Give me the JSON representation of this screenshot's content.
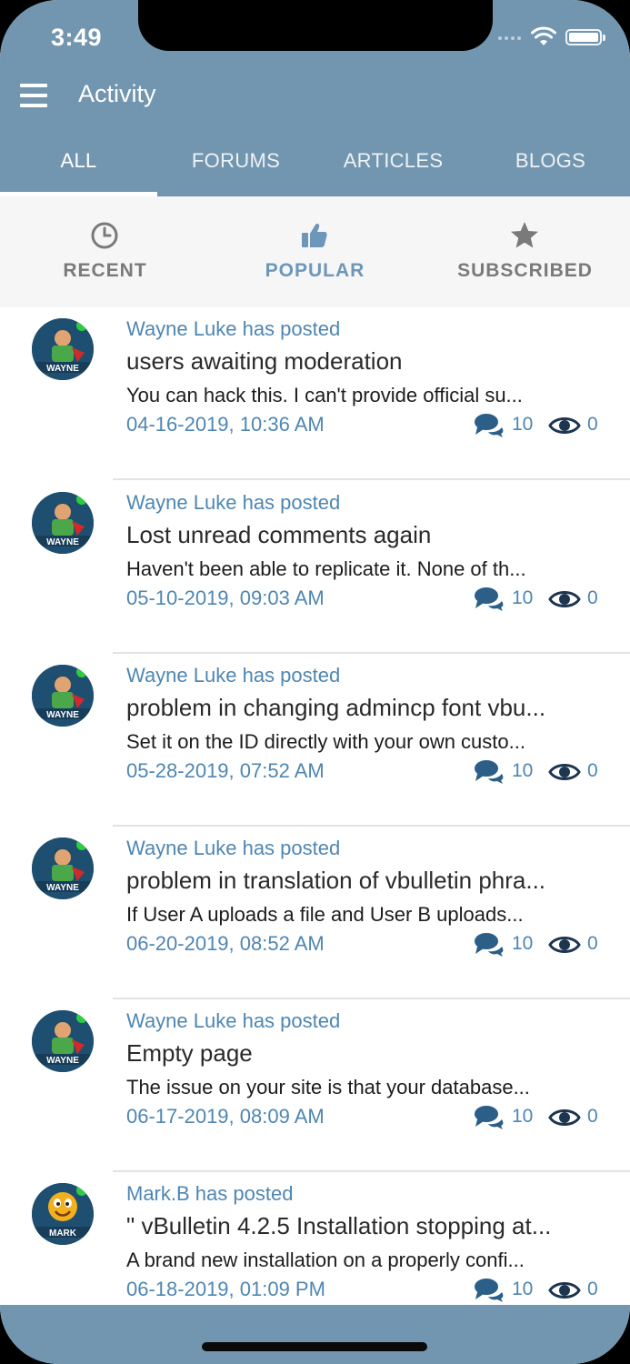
{
  "status_bar": {
    "time": "3:49"
  },
  "app_bar": {
    "title": "Activity",
    "menu_icon": "hamburger-icon"
  },
  "tabs": [
    {
      "label": "ALL",
      "selected": true
    },
    {
      "label": "FORUMS",
      "selected": false
    },
    {
      "label": "ARTICLES",
      "selected": false
    },
    {
      "label": "BLOGS",
      "selected": false
    }
  ],
  "filters": [
    {
      "label": "RECENT",
      "icon": "clock-icon",
      "selected": false
    },
    {
      "label": "POPULAR",
      "icon": "thumbs-up-icon",
      "selected": true
    },
    {
      "label": "SUBSCRIBED",
      "icon": "star-icon",
      "selected": false
    }
  ],
  "colors": {
    "header": "#7296af",
    "accent_text": "#4f86b2",
    "active_filter": "#6d97ba",
    "inactive_filter": "#7a7a7a"
  },
  "posts": [
    {
      "author": "Wayne Luke has posted",
      "title": "users awaiting moderation",
      "snippet": "You can hack this. I can't provide official su...",
      "date": "04-16-2019, 10:36 AM",
      "replies": "10",
      "views": "0",
      "avatar": "wayne-avatar"
    },
    {
      "author": "Wayne Luke has posted",
      "title": "Lost unread comments again",
      "snippet": "Haven't been able to replicate it. None of th...",
      "date": "05-10-2019, 09:03 AM",
      "replies": "10",
      "views": "0",
      "avatar": "wayne-avatar"
    },
    {
      "author": "Wayne Luke has posted",
      "title": "problem in changing admincp font vbu...",
      "snippet": "Set it on the ID directly with your own custo...",
      "date": "05-28-2019, 07:52 AM",
      "replies": "10",
      "views": "0",
      "avatar": "wayne-avatar"
    },
    {
      "author": "Wayne Luke has posted",
      "title": "problem in translation of vbulletin phra...",
      "snippet": "If User A uploads a file and User B uploads...",
      "date": "06-20-2019, 08:52 AM",
      "replies": "10",
      "views": "0",
      "avatar": "wayne-avatar"
    },
    {
      "author": "Wayne Luke has posted",
      "title": "Empty page",
      "snippet": "The issue on your site is that your database...",
      "date": "06-17-2019, 08:09 AM",
      "replies": "10",
      "views": "0",
      "avatar": "wayne-avatar"
    },
    {
      "author": "Mark.B has posted",
      "title": "\" vBulletin 4.2.5 Installation stopping at...",
      "snippet": "A brand new installation on a properly confi...",
      "date": "06-18-2019, 01:09 PM",
      "replies": "10",
      "views": "0",
      "avatar": "mark-avatar"
    }
  ]
}
